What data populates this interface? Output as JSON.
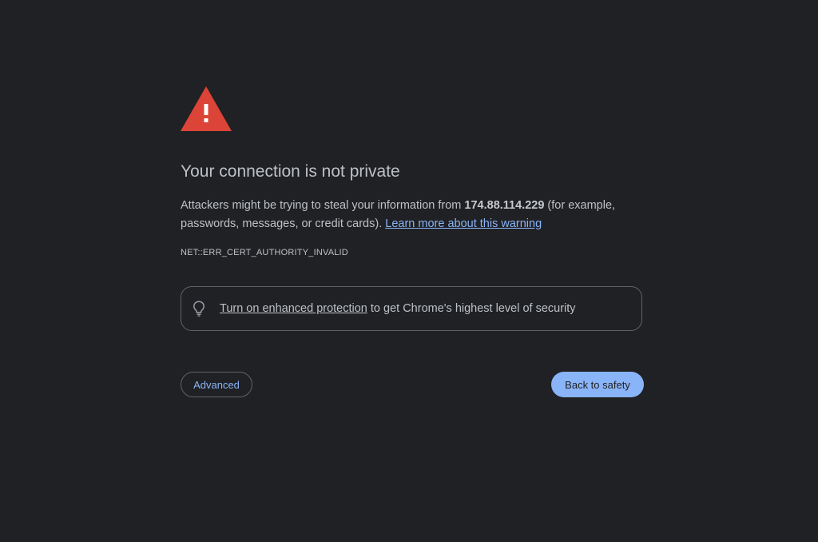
{
  "heading": {
    "title": "Your connection is not private"
  },
  "message": {
    "before_host": "Attackers might be trying to steal your information from ",
    "host": "174.88.114.229",
    "after_host": " (for example, passwords, messages, or credit cards). ",
    "learn_more_link": "Learn more about this warning"
  },
  "error_code": "NET::ERR_CERT_AUTHORITY_INVALID",
  "enhanced_protection": {
    "icon": "lightbulb-icon",
    "link_text": "Turn on enhanced protection",
    "suffix_text": " to get Chrome's highest level of security"
  },
  "buttons": {
    "advanced_label": "Advanced",
    "back_label": "Back to safety"
  },
  "icons": {
    "warning": "warning-triangle-icon"
  },
  "colors": {
    "background": "#202124",
    "warning_red": "#db4437",
    "text": "#bdc1c6",
    "link_blue": "#8ab4f8",
    "border": "#5f6368"
  }
}
